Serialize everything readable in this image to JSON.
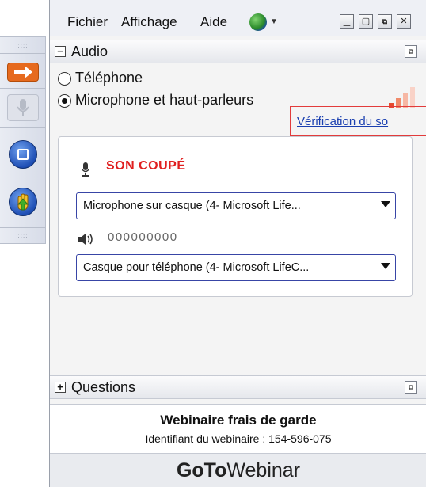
{
  "menu": {
    "items": [
      "Fichier",
      "Affichage",
      "Aide"
    ],
    "globe_icon": "globe-icon",
    "window_controls": [
      "minimize-icon",
      "restore-icon",
      "popout-icon",
      "close-icon"
    ]
  },
  "audio": {
    "header": "Audio",
    "options": [
      {
        "label": "Téléphone",
        "selected": false
      },
      {
        "label": "Microphone et haut-parleurs",
        "selected": true
      }
    ],
    "check_link": "Vérification du so",
    "mic_status": "SON COUPÉ",
    "microphone_select": "Microphone sur casque (4- Microsoft Life...",
    "speaker_level": "000000000",
    "speaker_select": "Casque pour téléphone (4- Microsoft LifeC..."
  },
  "questions": {
    "header": "Questions"
  },
  "webinar": {
    "title": "Webinaire frais de garde",
    "id_text": "Identifiant du webinaire : 154-596-075"
  },
  "brand": {
    "bold": "GoTo",
    "normal": "Webinar"
  },
  "colors": {
    "accent_orange": "#e66a1e",
    "muted_red": "#e02020",
    "link_blue": "#1a3fb0",
    "select_border": "#3845a6"
  }
}
